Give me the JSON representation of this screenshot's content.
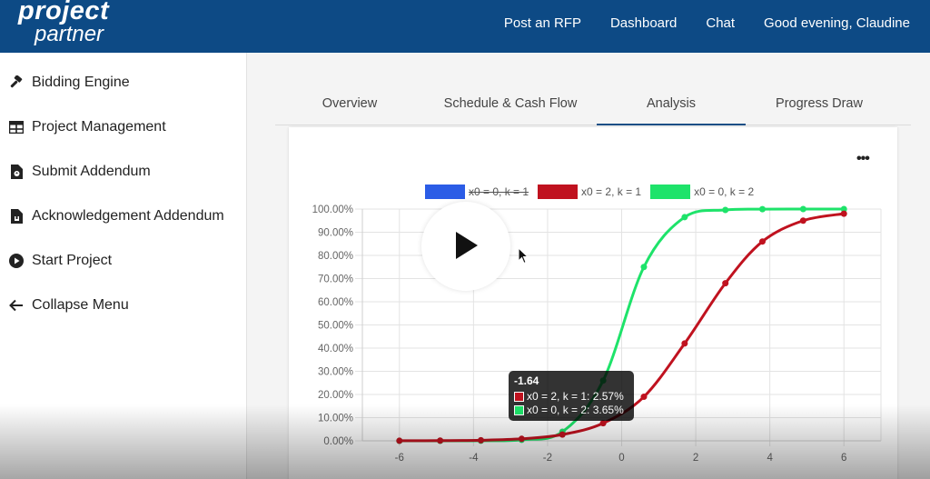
{
  "header": {
    "logo_line1": "project",
    "logo_line2": "partner",
    "nav": [
      "Post an RFP",
      "Dashboard",
      "Chat",
      "Good evening, Claudine"
    ]
  },
  "sidebar": {
    "items": [
      {
        "label": "Bidding Engine",
        "icon": "gavel-icon"
      },
      {
        "label": "Project Management",
        "icon": "table-icon"
      },
      {
        "label": "Submit Addendum",
        "icon": "file-upload-icon"
      },
      {
        "label": "Acknowledgement Addendum",
        "icon": "file-download-icon"
      },
      {
        "label": "Start Project",
        "icon": "play-circle-icon"
      },
      {
        "label": "Collapse Menu",
        "icon": "arrow-left-icon"
      }
    ]
  },
  "tabs": [
    "Overview",
    "Schedule & Cash Flow",
    "Analysis",
    "Progress Draw"
  ],
  "active_tab": "Analysis",
  "card": {
    "menu_icon": "more-horizontal-icon",
    "play_icon": "play-icon"
  },
  "tooltip": {
    "title": "-1.64",
    "rows": [
      {
        "label": "x0 = 2, k = 1: 2.57%",
        "color": "#c0121f"
      },
      {
        "label": "x0 = 0, k = 2: 3.65%",
        "color": "#1ee36a"
      }
    ]
  },
  "chart_data": {
    "type": "line",
    "x": [
      -6,
      -4.9,
      -3.8,
      -2.7,
      -1.6,
      -0.5,
      0.6,
      1.7,
      2.8,
      3.8,
      4.9,
      6
    ],
    "series": [
      {
        "name": "x0 = 0, k = 1",
        "color": "#2b5ce6",
        "hidden": true,
        "values": []
      },
      {
        "name": "x0 = 2, k = 1",
        "color": "#c0121f",
        "hidden": false,
        "values": [
          0.03,
          0.09,
          0.25,
          0.86,
          2.7,
          7.6,
          19.0,
          42.0,
          68.0,
          86.0,
          95.0,
          98.0
        ]
      },
      {
        "name": "x0 = 0, k = 2",
        "color": "#1ee36a",
        "hidden": false,
        "values": [
          0.0,
          0.0,
          0.05,
          0.45,
          3.9,
          26.0,
          75.0,
          96.5,
          99.6,
          99.95,
          100.0,
          100.0
        ]
      }
    ],
    "x_ticks": [
      -6,
      -4,
      -2,
      0,
      2,
      4,
      6
    ],
    "y_ticks": [
      "0.00%",
      "10.00%",
      "20.00%",
      "30.00%",
      "40.00%",
      "50.00%",
      "60.00%",
      "70.00%",
      "80.00%",
      "90.00%",
      "100.00%"
    ],
    "ylim": [
      0,
      100
    ],
    "xlim": [
      -7,
      7
    ],
    "grid": true,
    "legend_position": "top"
  }
}
